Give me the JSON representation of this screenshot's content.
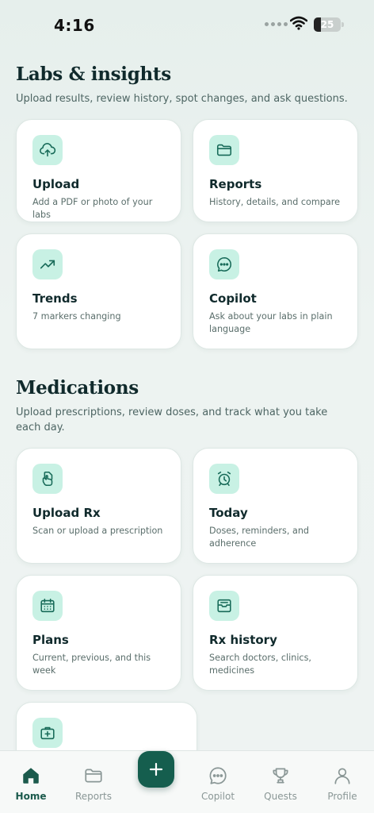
{
  "status": {
    "time": "4:16",
    "battery": "25"
  },
  "labs": {
    "title": "Labs & insights",
    "subtitle": "Upload results, review history, spot changes, and ask questions.",
    "cards": [
      {
        "title": "Upload",
        "desc": "Add a PDF or photo of your labs",
        "icon": "cloud-upload-icon"
      },
      {
        "title": "Reports",
        "desc": "History, details, and compare",
        "icon": "folder-icon"
      },
      {
        "title": "Trends",
        "desc": "7 markers changing",
        "icon": "trend-up-icon"
      },
      {
        "title": "Copilot",
        "desc": "Ask about your labs in plain language",
        "icon": "chat-icon"
      }
    ]
  },
  "meds": {
    "title": "Medications",
    "subtitle": "Upload prescriptions, review doses, and track what you take each day.",
    "cards": [
      {
        "title": "Upload Rx",
        "desc": "Scan or upload a prescription",
        "icon": "document-hand-icon"
      },
      {
        "title": "Today",
        "desc": "Doses, reminders, and adherence",
        "icon": "alarm-clock-icon"
      },
      {
        "title": "Plans",
        "desc": "Current, previous, and this week",
        "icon": "calendar-icon"
      },
      {
        "title": "Rx history",
        "desc": "Search doctors, clinics, medicines",
        "icon": "archive-box-icon"
      },
      {
        "title": "",
        "desc": "",
        "icon": "medical-kit-icon"
      }
    ]
  },
  "tabs": [
    {
      "label": "Home",
      "icon": "home-icon",
      "active": true
    },
    {
      "label": "Reports",
      "icon": "folder-icon"
    },
    {
      "label": "Copilot",
      "icon": "chat-icon"
    },
    {
      "label": "Quests",
      "icon": "trophy-icon"
    },
    {
      "label": "Profile",
      "icon": "person-icon"
    }
  ],
  "colors": {
    "accent": "#155e4e",
    "icon_bg": "#c8f1e4",
    "icon_stroke": "#176a58"
  }
}
